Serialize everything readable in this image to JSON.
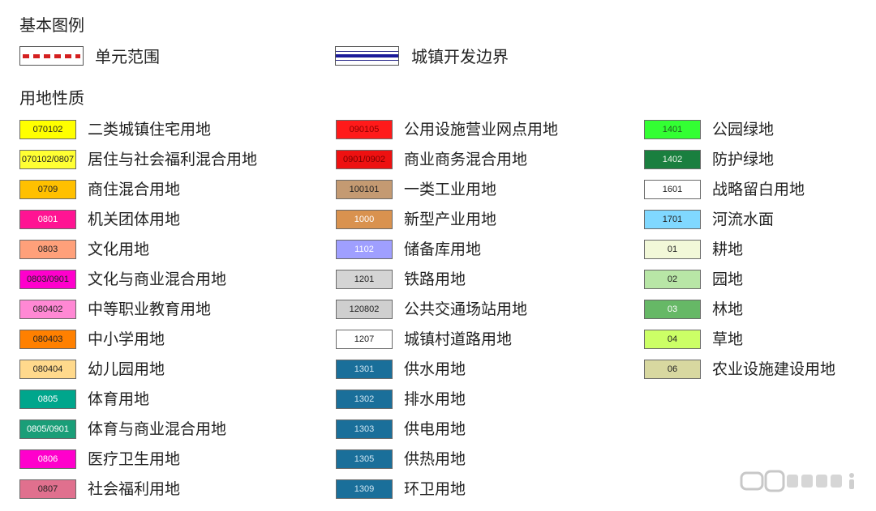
{
  "basic_legend": {
    "title": "基本图例",
    "unit_boundary_label": "单元范围",
    "urban_boundary_label": "城镇开发边界"
  },
  "land_use": {
    "title": "用地性质",
    "columns": [
      [
        {
          "code": "070102",
          "label": "二类城镇住宅用地",
          "color": "#ffff00",
          "text_color": "#222222"
        },
        {
          "code": "070102/0807",
          "label": "居住与社会福利混合用地",
          "color": "#ffff33",
          "text_color": "#222222"
        },
        {
          "code": "0709",
          "label": "商住混合用地",
          "color": "#ffc000",
          "text_color": "#222222"
        },
        {
          "code": "0801",
          "label": "机关团体用地",
          "color": "#ff1493",
          "text_color": "#ffffff"
        },
        {
          "code": "0803",
          "label": "文化用地",
          "color": "#ffa07a",
          "text_color": "#222222"
        },
        {
          "code": "0803/0901",
          "label": "文化与商业混合用地",
          "color": "#ff00cc",
          "text_color": "#222222"
        },
        {
          "code": "080402",
          "label": "中等职业教育用地",
          "color": "#ff88d4",
          "text_color": "#222222"
        },
        {
          "code": "080403",
          "label": "中小学用地",
          "color": "#ff8000",
          "text_color": "#222222"
        },
        {
          "code": "080404",
          "label": "幼儿园用地",
          "color": "#ffd98c",
          "text_color": "#222222"
        },
        {
          "code": "0805",
          "label": "体育用地",
          "color": "#00a68c",
          "text_color": "#ffffff"
        },
        {
          "code": "0805/0901",
          "label": "体育与商业混合用地",
          "color": "#1a9e78",
          "text_color": "#ffffff"
        },
        {
          "code": "0806",
          "label": "医疗卫生用地",
          "color": "#ff00cc",
          "text_color": "#ffffff"
        },
        {
          "code": "0807",
          "label": "社会福利用地",
          "color": "#e0708e",
          "text_color": "#222222"
        }
      ],
      [
        {
          "code": "090105",
          "label": "公用设施营业网点用地",
          "color": "#ff1a1a",
          "text_color": "#8a0000"
        },
        {
          "code": "0901/0902",
          "label": "商业商务混合用地",
          "color": "#ee1111",
          "text_color": "#7a0000"
        },
        {
          "code": "100101",
          "label": "一类工业用地",
          "color": "#c49a72",
          "text_color": "#222222"
        },
        {
          "code": "1000",
          "label": "新型产业用地",
          "color": "#d9924f",
          "text_color": "#ffffff"
        },
        {
          "code": "1102",
          "label": "储备库用地",
          "color": "#9f9fff",
          "text_color": "#ffffff"
        },
        {
          "code": "1201",
          "label": "铁路用地",
          "color": "#d4d4d4",
          "text_color": "#222222"
        },
        {
          "code": "120802",
          "label": "公共交通场站用地",
          "color": "#cfcfcf",
          "text_color": "#222222"
        },
        {
          "code": "1207",
          "label": "城镇村道路用地",
          "color": "#ffffff",
          "text_color": "#222222"
        },
        {
          "code": "1301",
          "label": "供水用地",
          "color": "#1a6f9a",
          "text_color": "#cfe6f2"
        },
        {
          "code": "1302",
          "label": "排水用地",
          "color": "#1a6f9a",
          "text_color": "#cfe6f2"
        },
        {
          "code": "1303",
          "label": "供电用地",
          "color": "#1a6f9a",
          "text_color": "#cfe6f2"
        },
        {
          "code": "1305",
          "label": "供热用地",
          "color": "#1a6f9a",
          "text_color": "#cfe6f2"
        },
        {
          "code": "1309",
          "label": "环卫用地",
          "color": "#1a6f9a",
          "text_color": "#cfe6f2"
        }
      ],
      [
        {
          "code": "1401",
          "label": "公园绿地",
          "color": "#33ff33",
          "text_color": "#1f5f1f"
        },
        {
          "code": "1402",
          "label": "防护绿地",
          "color": "#1a7f3f",
          "text_color": "#e8f5e8"
        },
        {
          "code": "1601",
          "label": "战略留白用地",
          "color": "#ffffff",
          "text_color": "#222222"
        },
        {
          "code": "1701",
          "label": "河流水面",
          "color": "#80d8ff",
          "text_color": "#222222"
        },
        {
          "code": "01",
          "label": "耕地",
          "color": "#f2f8d8",
          "text_color": "#222222"
        },
        {
          "code": "02",
          "label": "园地",
          "color": "#b8e6a6",
          "text_color": "#222222"
        },
        {
          "code": "03",
          "label": "林地",
          "color": "#66b866",
          "text_color": "#ffffff"
        },
        {
          "code": "04",
          "label": "草地",
          "color": "#ccff66",
          "text_color": "#222222"
        },
        {
          "code": "06",
          "label": "农业设施建设用地",
          "color": "#d8d8a0",
          "text_color": "#222222"
        }
      ]
    ]
  }
}
